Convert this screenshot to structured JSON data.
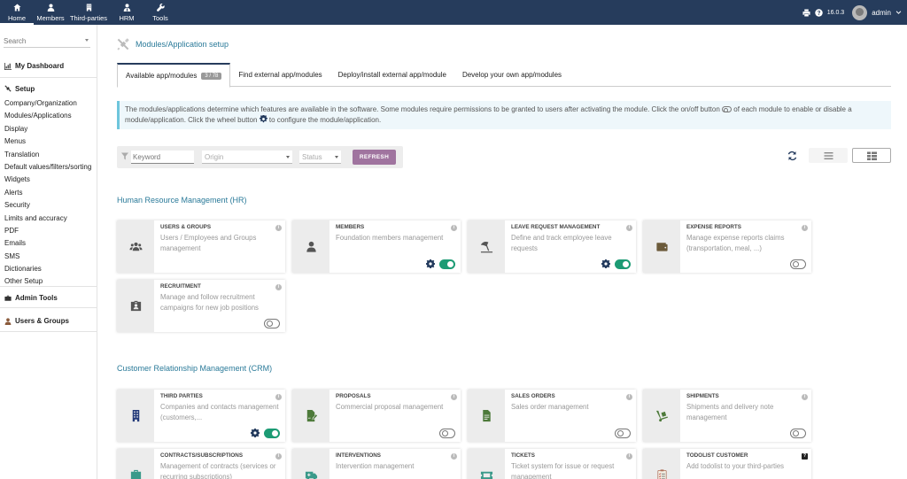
{
  "topmenu": [
    {
      "label": "Home",
      "icon": "home-icon",
      "active": true
    },
    {
      "label": "Members",
      "icon": "user-icon"
    },
    {
      "label": "Third-parties",
      "icon": "building-icon"
    },
    {
      "label": "HRM",
      "icon": "user-tie-icon"
    },
    {
      "label": "Tools",
      "icon": "wrench-icon"
    }
  ],
  "topright": {
    "version": "16.0.3",
    "username": "admin"
  },
  "sidebar": {
    "search_placeholder": "Search",
    "dashboard": "My Dashboard",
    "setup": "Setup",
    "setup_items": [
      "Company/Organization",
      "Modules/Applications",
      "Display",
      "Menus",
      "Translation",
      "Default values/filters/sorting",
      "Widgets",
      "Alerts",
      "Security",
      "Limits and accuracy",
      "PDF",
      "Emails",
      "SMS",
      "Dictionaries",
      "Other Setup"
    ],
    "admin_tools": "Admin Tools",
    "users_groups": "Users & Groups"
  },
  "page": {
    "title": "Modules/Application setup",
    "tabs": [
      {
        "label": "Available app/modules",
        "badge": "3 / 78",
        "active": true
      },
      {
        "label": "Find external app/modules"
      },
      {
        "label": "Deploy/install external app/module"
      },
      {
        "label": "Develop your own app/modules"
      }
    ],
    "info_line1": "The modules/applications determine which features are available in the software. Some modules require permissions to be granted to users after activating the module. Click the on/off button",
    "info_line1b": "of each module to enable or disable a",
    "info_line2a": "module/application. Click the wheel button",
    "info_line2b": "to configure the module/application."
  },
  "filters": {
    "keyword_placeholder": "Keyword",
    "origin_placeholder": "Origin",
    "status_placeholder": "Status",
    "refresh_label": "REFRESH"
  },
  "colors": {
    "topbar": "#263c5c",
    "accent_text": "#2a7a99",
    "toggle_on": "#1c9b74",
    "refresh": "#a0749f"
  },
  "sections": [
    {
      "title": "Human Resource Management (HR)",
      "cards": [
        {
          "name": "USERS & GROUPS",
          "desc": "Users / Employees and Groups management",
          "icon": "users-icon",
          "enabled": null
        },
        {
          "name": "MEMBERS",
          "desc": "Foundation members management",
          "icon": "user-icon",
          "enabled": true
        },
        {
          "name": "LEAVE REQUEST MANAGEMENT",
          "desc": "Define and track employee leave requests",
          "icon": "umbrella-beach-icon",
          "enabled": true
        },
        {
          "name": "EXPENSE REPORTS",
          "desc": "Manage expense reports claims (transportation, meal, ...)",
          "icon": "wallet-icon",
          "enabled": false
        },
        {
          "name": "RECRUITMENT",
          "desc": "Manage and follow recruitment campaigns for new job positions",
          "icon": "id-badge-icon",
          "enabled": false
        }
      ]
    },
    {
      "title": "Customer Relationship Management (CRM)",
      "cards": [
        {
          "name": "THIRD PARTIES",
          "desc": "Companies and contacts management (customers,...",
          "icon": "building-icon",
          "enabled": true
        },
        {
          "name": "PROPOSALS",
          "desc": "Commercial proposal management",
          "icon": "file-signature-icon",
          "enabled": false
        },
        {
          "name": "SALES ORDERS",
          "desc": "Sales order management",
          "icon": "file-invoice-icon",
          "enabled": false
        },
        {
          "name": "SHIPMENTS",
          "desc": "Shipments and delivery note management",
          "icon": "dolly-icon",
          "enabled": false
        },
        {
          "name": "CONTRACTS/SUBSCRIPTIONS",
          "desc": "Management of contracts (services or recurring subscriptions)",
          "icon": "suitcase-icon",
          "enabled": null
        },
        {
          "name": "INTERVENTIONS",
          "desc": "Intervention management",
          "icon": "ambulance-icon",
          "enabled": null
        },
        {
          "name": "TICKETS",
          "desc": "Ticket system for issue or request management",
          "icon": "ticket-icon",
          "enabled": null
        },
        {
          "name": "TODOLIST CUSTOMER",
          "desc": "Add todolist to your third-parties",
          "icon": "clipboard-list-icon",
          "enabled": null
        }
      ]
    }
  ]
}
